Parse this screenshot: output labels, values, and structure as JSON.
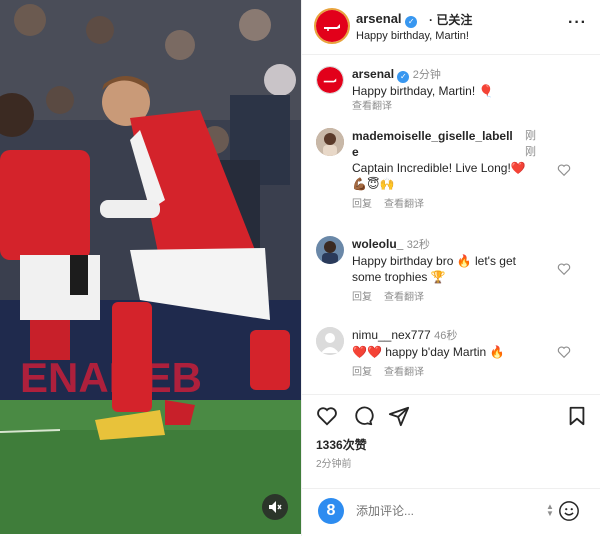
{
  "header": {
    "username": "arsenal",
    "follow_status": "· 已关注",
    "subtitle": "Happy birthday, Martin!",
    "more_icon": "more-dots-icon"
  },
  "caption": {
    "username": "arsenal",
    "time": "2分钟",
    "text": "Happy birthday, Martin!",
    "emoji": "🎈",
    "see_translation": "查看翻译"
  },
  "comments": [
    {
      "username_line1": "mademoiselle_giselle_labell",
      "username_line2": "e",
      "time_line1": "刚",
      "time_line2": "刚",
      "text_line1": "Captain Incredible! Live Long!❤️",
      "text_line2": "💪🏾😇🙌",
      "reply": "回复",
      "see_translation": "查看翻译"
    },
    {
      "username": "woleolu_",
      "time": "32秒",
      "text_line1": "Happy birthday bro 🔥 let's get",
      "text_line2": "some trophies 🏆",
      "reply": "回复",
      "see_translation": "查看翻译"
    },
    {
      "username": "nimu__nex777",
      "time": "46秒",
      "text": "❤️❤️ happy b'day Martin 🔥",
      "reply": "回复",
      "see_translation": "查看翻译"
    }
  ],
  "stats": {
    "likes": "1336次赞",
    "posted": "2分钟前"
  },
  "add_comment": {
    "placeholder": "添加评论...",
    "avatar_letter": "8"
  },
  "colors": {
    "accent": "#3897f0",
    "brand_red": "#e2001a",
    "muted": "#8e8e8e",
    "heart_red": "#ed1c24"
  }
}
